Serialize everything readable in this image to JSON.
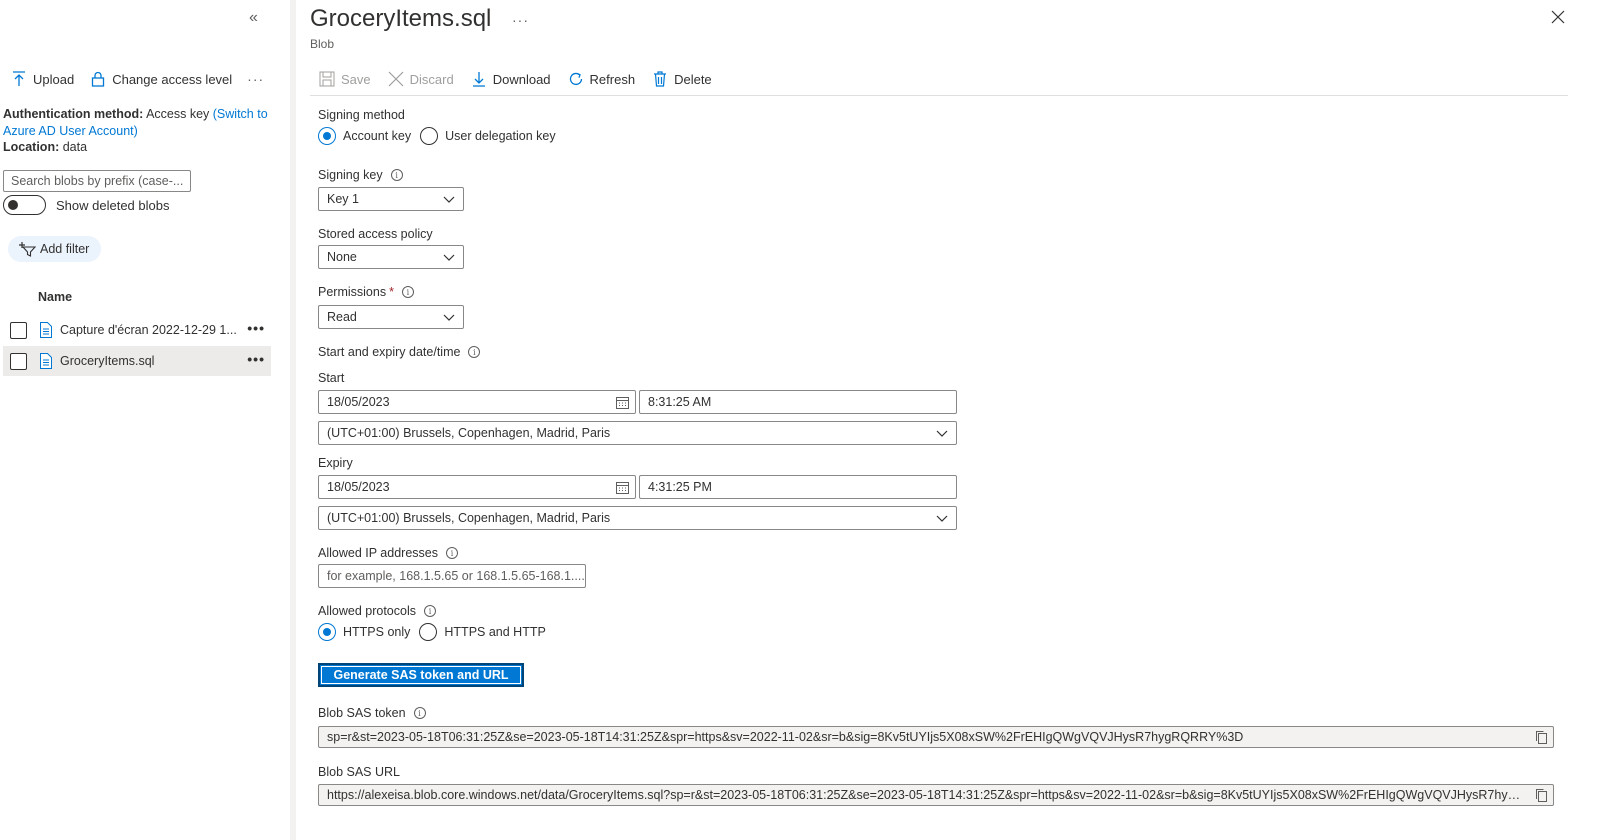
{
  "left": {
    "toolbar": {
      "upload": "Upload",
      "change_access": "Change access level",
      "more": "···"
    },
    "auth": {
      "label": "Authentication method:",
      "value": "Access key",
      "switch_link": "(Switch to Azure AD User Account)",
      "location_label": "Location:",
      "location_value": "data"
    },
    "search_placeholder": "Search blobs by prefix (case-...",
    "show_deleted": "Show deleted blobs",
    "add_filter": "Add filter",
    "column_name": "Name",
    "files": [
      {
        "name": "Capture d'écran 2022-12-29 1..."
      },
      {
        "name": "GroceryItems.sql"
      }
    ]
  },
  "header": {
    "title": "GroceryItems.sql",
    "subtitle": "Blob",
    "more": "···"
  },
  "toolbar": {
    "save": "Save",
    "discard": "Discard",
    "download": "Download",
    "refresh": "Refresh",
    "delete": "Delete"
  },
  "form": {
    "signing_method": {
      "label": "Signing method",
      "options": [
        "Account key",
        "User delegation key"
      ],
      "selected": "Account key"
    },
    "signing_key": {
      "label": "Signing key",
      "value": "Key 1"
    },
    "stored_policy": {
      "label": "Stored access policy",
      "value": "None"
    },
    "permissions": {
      "label": "Permissions",
      "required": "*",
      "value": "Read"
    },
    "start_expiry": {
      "label": "Start and expiry date/time"
    },
    "start": {
      "label": "Start",
      "date": "18/05/2023",
      "time": "8:31:25 AM",
      "timezone": "(UTC+01:00) Brussels, Copenhagen, Madrid, Paris"
    },
    "expiry": {
      "label": "Expiry",
      "date": "18/05/2023",
      "time": "4:31:25 PM",
      "timezone": "(UTC+01:00) Brussels, Copenhagen, Madrid, Paris"
    },
    "allowed_ip": {
      "label": "Allowed IP addresses",
      "placeholder": "for example, 168.1.5.65 or 168.1.5.65-168.1...."
    },
    "allowed_protocols": {
      "label": "Allowed protocols",
      "options": [
        "HTTPS only",
        "HTTPS and HTTP"
      ],
      "selected": "HTTPS only"
    },
    "generate_button": "Generate SAS token and URL",
    "sas_token": {
      "label": "Blob SAS token",
      "value": "sp=r&st=2023-05-18T06:31:25Z&se=2023-05-18T14:31:25Z&spr=https&sv=2022-11-02&sr=b&sig=8Kv5tUYIjs5X08xSW%2FrEHIgQWgVQVJHysR7hygRQRRY%3D"
    },
    "sas_url": {
      "label": "Blob SAS URL",
      "value": "https://alexeisa.blob.core.windows.net/data/GroceryItems.sql?sp=r&st=2023-05-18T06:31:25Z&se=2023-05-18T14:31:25Z&spr=https&sv=2022-11-02&sr=b&sig=8Kv5tUYIjs5X08xSW%2FrEHIgQWgVQVJHysR7hyg..."
    }
  },
  "colors": {
    "accent": "#0078d4",
    "selected_row": "#edebe9",
    "filter_pill": "#ebf3fc"
  }
}
